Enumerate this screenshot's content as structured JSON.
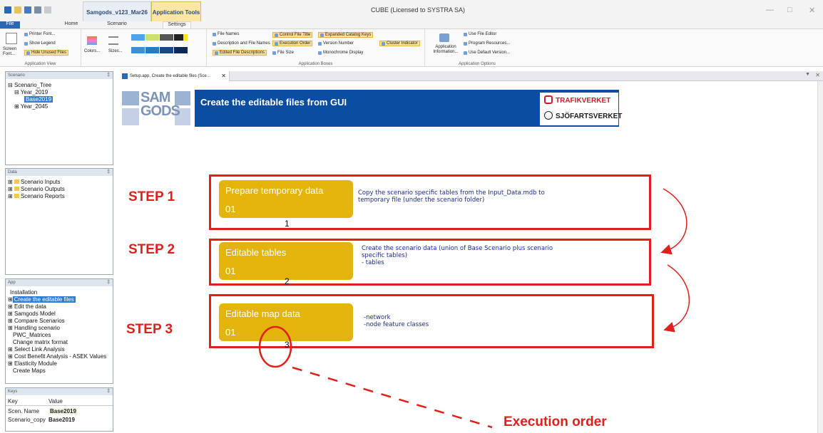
{
  "window": {
    "title": "CUBE (Licensed to SYSTRA SA)",
    "context_tab_project": "Samgods_v123_Mar26",
    "context_tab_tools": "Application Tools"
  },
  "ribbon": {
    "tabs": [
      "File",
      "Home",
      "Scenario",
      "Settings"
    ],
    "groups": {
      "view": {
        "label": "Application View",
        "items": [
          "Printer Font...",
          "Show Legend",
          "Hide Unused Files",
          "Screen Font..."
        ]
      },
      "colors": {
        "colors_label": "Colors...",
        "sizes_label": "Sizes..."
      },
      "boxes": {
        "label": "Application Boxes",
        "col1": [
          "File Names",
          "Description and File Names",
          "Edited File Descriptions"
        ],
        "col2": [
          "Control File Title",
          "Execution Order",
          "File Size"
        ],
        "col3": [
          "Expanded Catalog Keys",
          "Version Number",
          "Monochrome Display"
        ],
        "col4": [
          "Cluster Indicator"
        ]
      },
      "options": {
        "label": "Application Options",
        "info_label": "Application Information...",
        "items": [
          "Use File Editor",
          "Program Resources...",
          "Use Default Version..."
        ]
      }
    }
  },
  "panes": {
    "scenario": {
      "title": "Scenario",
      "items": [
        "Scenario_Tree",
        "Year_2019",
        "Base2019",
        "Year_2045"
      ]
    },
    "data": {
      "title": "Data",
      "items": [
        "Scenario Inputs",
        "Scenario Outputs",
        "Scenario Reports"
      ]
    },
    "app": {
      "title": "App",
      "items": [
        "Installation",
        "Create the editable files",
        "Edit the data",
        "Samgods Model",
        "Compare Scenarios",
        "Handling scenario",
        "PWC_Matrices",
        "Change matrix format",
        "Select Link Analysis",
        "Cost Benefit Analysis - ASEK Values",
        "Elasticity Module",
        "Create Maps"
      ]
    },
    "keys": {
      "title": "Keys",
      "col_key": "Key",
      "col_value": "Value",
      "rows": [
        {
          "key": "Scen. Name",
          "value": "Base2019"
        },
        {
          "key": "Scenario_copy",
          "value": "Base2019"
        }
      ]
    }
  },
  "document": {
    "tab_label": "Setup.app, Create the editable files (Sce...",
    "banner": {
      "logo_line1": "SAM",
      "logo_line2": "GODS",
      "title": "Create the editable files from GUI",
      "agency1": "TRAFIKVERKET",
      "agency2": "SJÖFARTSVERKET"
    },
    "steps": [
      {
        "label": "STEP 1",
        "pill_title": "Prepare temporary data",
        "pill_number": "01",
        "order": "1",
        "desc": [
          "Copy the scenario specific tables from the Input_Data.mdb to",
          "temporary file (under the scenario folder)"
        ]
      },
      {
        "label": "STEP 2",
        "pill_title": "Editable tables",
        "pill_number": "01",
        "order": "2",
        "desc": [
          "Create the scenario data (union of Base Scenario plus scenario",
          "specific tables)",
          "- tables"
        ]
      },
      {
        "label": "STEP 3",
        "pill_title": "Editable map data",
        "pill_number": "01",
        "order": "3",
        "desc": [
          "-network",
          "-node feature classes"
        ]
      }
    ],
    "annotation": "Execution order"
  },
  "colors": {
    "accent_red": "#e0201b",
    "pill": "#e3b40c",
    "banner": "#0a4da1",
    "selection": "#2f7bd9"
  }
}
